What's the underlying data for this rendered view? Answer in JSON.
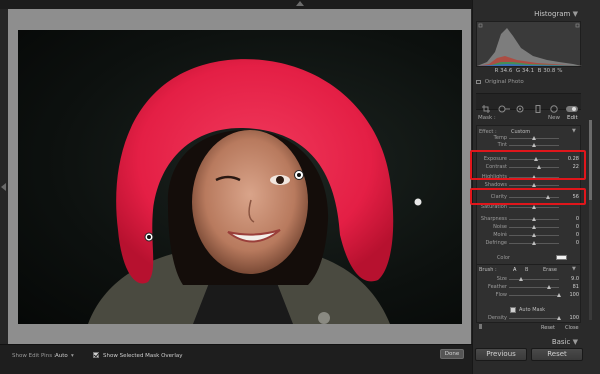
{
  "app": {
    "name": "Lightroom Develop"
  },
  "panels": {
    "histogram_title": "Histogram",
    "basic_title": "Basic"
  },
  "histogram": {
    "r_label": "R",
    "r_value": "34.6",
    "g_label": "G",
    "g_value": "34.1",
    "b_label": "B",
    "b_value": "30.8",
    "percent": "%",
    "original_photo": "Original Photo"
  },
  "mask": {
    "label": "Mask :",
    "new": "New",
    "edit": "Edit"
  },
  "effect": {
    "label": "Effect :",
    "preset": "Custom",
    "sliders": [
      {
        "label": "Temp",
        "value": "",
        "level": 0.5
      },
      {
        "label": "Tint",
        "value": "",
        "level": 0.5
      },
      {
        "label": "Exposure",
        "value": "0.28",
        "level": 0.55
      },
      {
        "label": "Contrast",
        "value": "22",
        "level": 0.6
      },
      {
        "label": "Highlights",
        "value": "",
        "level": 0.5
      },
      {
        "label": "Shadows",
        "value": "",
        "level": 0.5
      },
      {
        "label": "Clarity",
        "value": "56",
        "level": 0.78
      },
      {
        "label": "Saturation",
        "value": "",
        "level": 0.5
      },
      {
        "label": "Sharpness",
        "value": "0",
        "level": 0.5
      },
      {
        "label": "Noise",
        "value": "0",
        "level": 0.5
      },
      {
        "label": "Moiré",
        "value": "0",
        "level": 0.5
      },
      {
        "label": "Defringe",
        "value": "0",
        "level": 0.5
      }
    ],
    "color_label": "Color"
  },
  "brush": {
    "label": "Brush :",
    "a": "A",
    "b": "B",
    "erase": "Erase",
    "size_label": "Size",
    "size_value": "9.0",
    "feather_label": "Feather",
    "feather_value": "81",
    "flow_label": "Flow",
    "flow_value": "100",
    "automask_label": "Auto Mask",
    "density_label": "Density",
    "density_value": "100",
    "reset": "Reset",
    "close": "Close"
  },
  "buttons": {
    "previous": "Previous",
    "reset": "Reset",
    "done": "Done"
  },
  "toolbar": {
    "show_edit_pins_label": "Show Edit Pins :",
    "show_edit_pins_value": "Auto",
    "show_mask_overlay": "Show Selected Mask Overlay"
  },
  "colors": {
    "highlight": "#e0161b",
    "mask_overlay": "#ea1e4a"
  }
}
